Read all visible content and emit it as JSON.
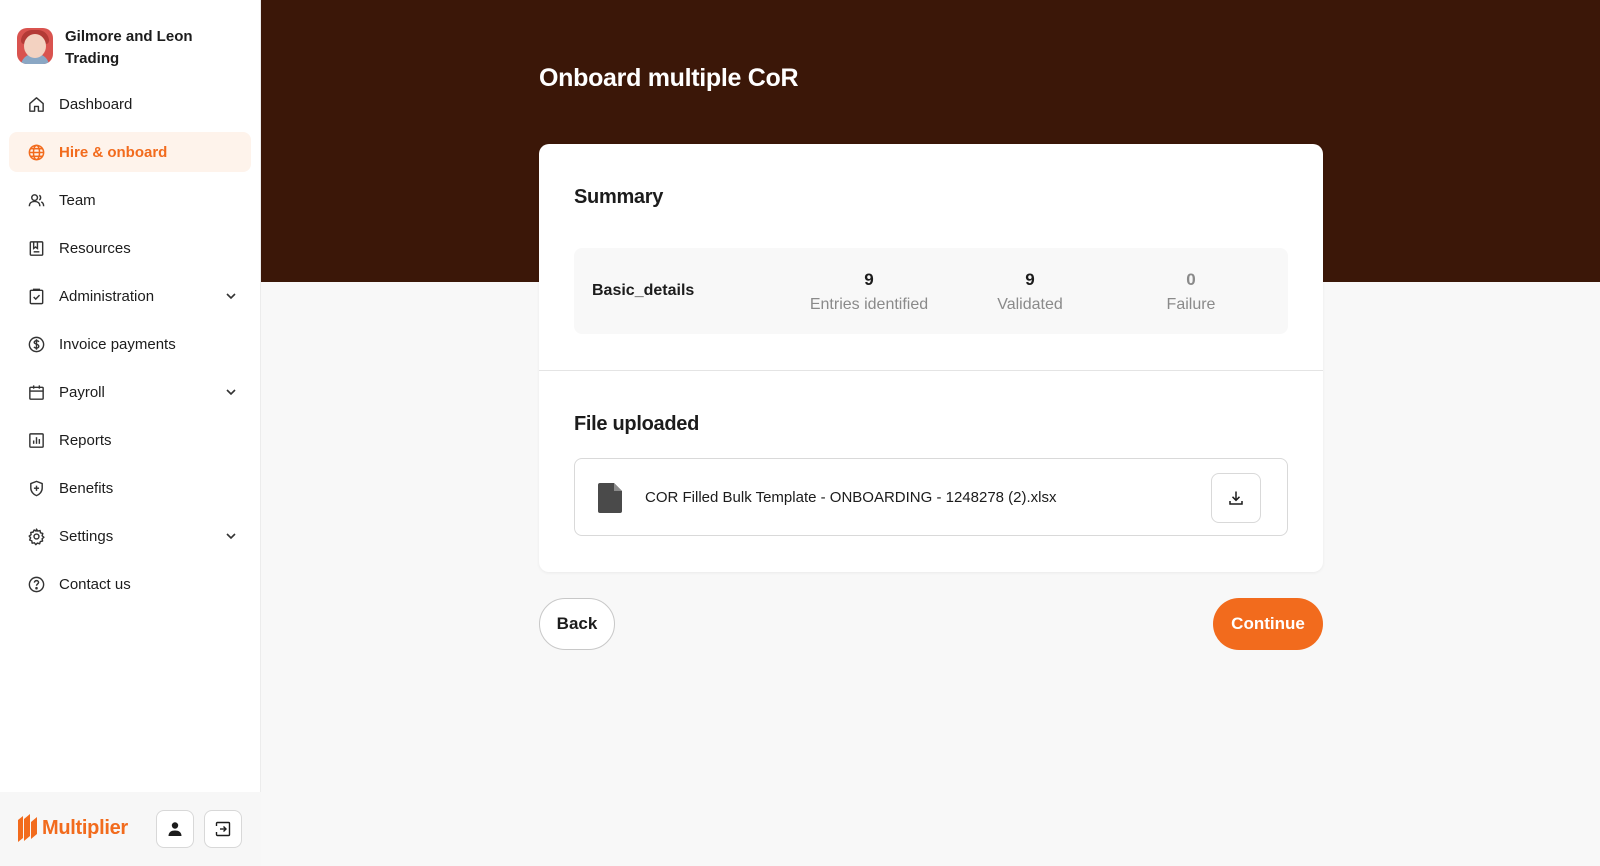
{
  "company": {
    "name": "Gilmore and Leon Trading"
  },
  "nav": [
    {
      "label": "Dashboard",
      "icon": "home-icon",
      "active": false,
      "expandable": false
    },
    {
      "label": "Hire & onboard",
      "icon": "globe-icon",
      "active": true,
      "expandable": false
    },
    {
      "label": "Team",
      "icon": "users-icon",
      "active": false,
      "expandable": false
    },
    {
      "label": "Resources",
      "icon": "book-icon",
      "active": false,
      "expandable": false
    },
    {
      "label": "Administration",
      "icon": "clipboard-check-icon",
      "active": false,
      "expandable": true
    },
    {
      "label": "Invoice payments",
      "icon": "dollar-circle-icon",
      "active": false,
      "expandable": false
    },
    {
      "label": "Payroll",
      "icon": "calendar-icon",
      "active": false,
      "expandable": true
    },
    {
      "label": "Reports",
      "icon": "bar-chart-icon",
      "active": false,
      "expandable": false
    },
    {
      "label": "Benefits",
      "icon": "shield-plus-icon",
      "active": false,
      "expandable": false
    },
    {
      "label": "Settings",
      "icon": "gear-icon",
      "active": false,
      "expandable": true
    },
    {
      "label": "Contact us",
      "icon": "help-circle-icon",
      "active": false,
      "expandable": false
    }
  ],
  "brand": {
    "name": "Multiplier"
  },
  "page": {
    "title": "Onboard multiple CoR"
  },
  "summary": {
    "title": "Summary",
    "sheet": "Basic_details",
    "stats": [
      {
        "value": "9",
        "label": "Entries identified"
      },
      {
        "value": "9",
        "label": "Validated"
      },
      {
        "value": "0",
        "label": "Failure"
      }
    ]
  },
  "file": {
    "title": "File uploaded",
    "name": "COR Filled Bulk Template - ONBOARDING - 1248278 (2).xlsx"
  },
  "actions": {
    "back": "Back",
    "continue": "Continue"
  },
  "colors": {
    "accent": "#f26b1d",
    "hero": "#3b1708",
    "active_bg": "#fef3eb"
  }
}
